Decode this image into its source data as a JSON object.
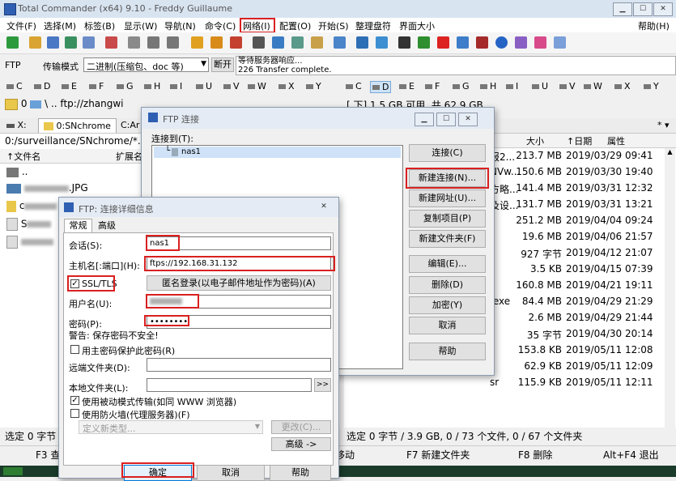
{
  "window": {
    "title": "Total Commander (x64) 9.10 - Freddy Guillaume"
  },
  "menu": [
    "文件(F)",
    "选择(M)",
    "标签(B)",
    "显示(W)",
    "导航(N)",
    "命令(C)",
    "网络(I)",
    "配置(O)",
    "开始(S)",
    "整理盘符",
    "界面大小"
  ],
  "help_menu": "帮助(H)",
  "ftpbar": {
    "label": "FTP",
    "transfer_label": "传输模式",
    "transfer_mode": "二进制(压缩包、doc 等)",
    "disconnect": "断开",
    "log_line1": "等待服务器响应...",
    "log_line2": "226 Transfer complete."
  },
  "drives": [
    "C",
    "D",
    "E",
    "F",
    "G",
    "H",
    "I",
    "U",
    "V",
    "W",
    "X",
    "Y"
  ],
  "left_path": {
    "drive": "0",
    "text": "\\  ..  ftp://zhangwi"
  },
  "right_space": "[ 下] 1.5 GB 可用, 共 62.9 GB",
  "tabs": {
    "x_tab": "X:",
    "snchrome_tab": "0:SNchrome",
    "third_tab": "C:Ar"
  },
  "left_panel": {
    "path": "0:/surveillance/SNchrome/*.",
    "col_name": "↑文件名",
    "col_ext": "扩展名",
    "up": "..",
    "jpg": ".JPG",
    "row3": "c",
    "row4": "S",
    "status": "选定 0 字节 /"
  },
  "right_panel": {
    "col_size": "大小",
    "col_date": "↑日期",
    "col_attr": "属性",
    "frag": [
      "报2...",
      "NVw...",
      "方略...",
      "及设...",
      "",
      "",
      "",
      "",
      "",
      ".exe",
      "",
      "",
      "",
      "",
      "sr",
      ""
    ],
    "sizes": [
      "213.7 MB",
      "150.6 MB",
      "141.4 MB",
      "131.7 MB",
      "251.2 MB",
      "19.6 MB",
      "927 字节",
      "3.5 KB",
      "160.8 MB",
      "84.4 MB",
      "2.6 MB",
      "35 字节",
      "153.8 KB",
      "62.9 KB",
      "115.9 KB"
    ],
    "dates": [
      "2019/03/29 09:41",
      "2019/03/30 19:40",
      "2019/03/31 12:32",
      "2019/03/31 13:21",
      "2019/04/04 09:24",
      "2019/04/06 21:57",
      "2019/04/12 21:07",
      "2019/04/15 07:39",
      "2019/04/21 19:11",
      "2019/04/29 21:29",
      "2019/04/29 21:44",
      "2019/04/30 20:14",
      "2019/05/11 12:08",
      "2019/05/11 12:09",
      "2019/05/11 12:11"
    ],
    "status": "选定 0 字节 / 3.9 GB, 0 / 73 个文件, 0 / 67 个文件夹"
  },
  "fkeys": {
    "f3": "F3 查",
    "move": "移动",
    "f7": "F7 新建文件夹",
    "f8": "F8 删除",
    "exit": "Alt+F4 退出"
  },
  "ftp_dialog": {
    "title": "FTP 连接",
    "connect_to": "连接到(T):",
    "item": "nas1",
    "buttons": [
      "连接(C)",
      "新建连接(N)...",
      "新建网址(U)...",
      "复制项目(P)",
      "新建文件夹(F)",
      "编辑(E)...",
      "删除(D)",
      "加密(Y)",
      "取消",
      "帮助"
    ]
  },
  "detail_dialog": {
    "title": "FTP: 连接详细信息",
    "tab_general": "常规",
    "tab_advanced": "高级",
    "session_label": "会话(S):",
    "session_value": "nas1",
    "host_label": "主机名[:端口](H):",
    "host_value": "ftps://192.168.31.132",
    "ssl_label": "SSL/TLS",
    "anon_button": "匿名登录(以电子邮件地址作为密码)(A)",
    "user_label": "用户名(U):",
    "pass_label": "密码(P):",
    "pass_value": "••••••••",
    "warning": "警告: 保存密码不安全!",
    "master_pw": "用主密码保护此密码(R)",
    "remote_label": "远端文件夹(D):",
    "local_label": "本地文件夹(L):",
    "browse": ">>",
    "passive": "使用被动模式传输(如同 WWW 浏览器)",
    "firewall": "使用防火墙(代理服务器)(F)",
    "proxy_placeholder": "定义新类型...",
    "change_button": "更改(C)...",
    "advanced_button": "高级 ->",
    "ok": "确定",
    "cancel": "取消",
    "help": "帮助"
  }
}
